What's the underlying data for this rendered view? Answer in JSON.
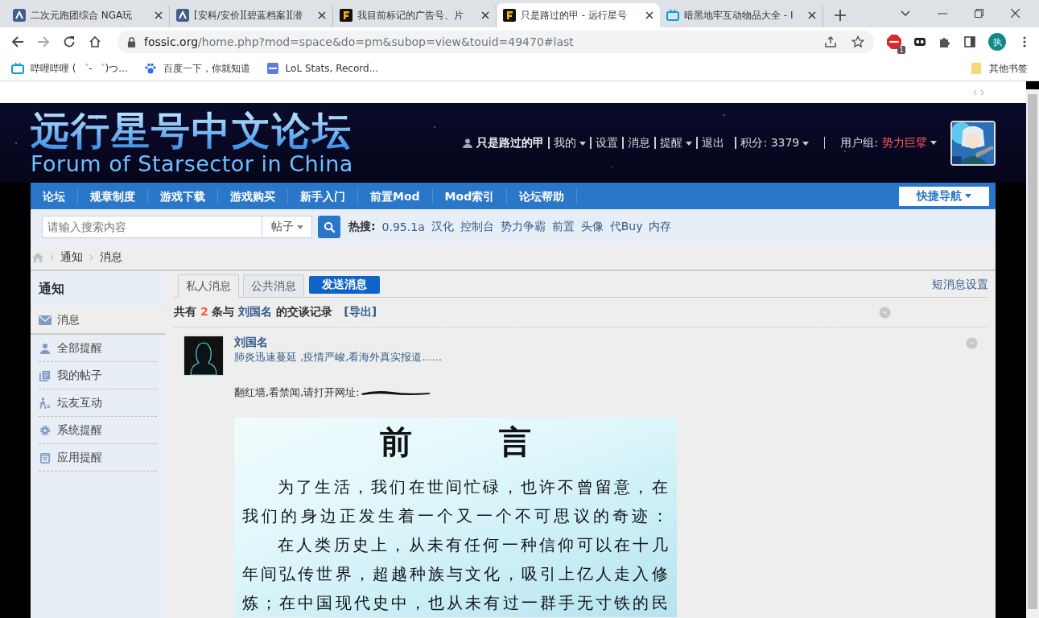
{
  "browser": {
    "tabs": [
      {
        "title": "二次元跑团综合 NGA玩",
        "selected": false,
        "kind": "nga"
      },
      {
        "title": "[安科/安价][碧蓝档案][潜",
        "selected": false,
        "kind": "nga"
      },
      {
        "title": "我目前标记的广告号、片",
        "selected": false,
        "kind": "fossic"
      },
      {
        "title": "只是路过的甲 - 远行星号",
        "selected": true,
        "kind": "fossic"
      },
      {
        "title": "暗黑地牢互动物品大全 - I",
        "selected": false,
        "kind": "bili"
      }
    ],
    "url": {
      "host": "fossic.org",
      "path": "/home.php?mod=space&do=pm&subop=view&touid=49470#last"
    },
    "extension_badge": "1",
    "profile_initial": "执",
    "bookmarks": [
      {
        "label": "哔哩哔哩 ( ゜- ゜)つ..."
      },
      {
        "label": "百度一下，你就知道"
      },
      {
        "label": "LoL Stats, Record..."
      }
    ],
    "other_bookmarks": "其他书签"
  },
  "site": {
    "logo_cn": "远行星号中文论坛",
    "logo_en": "Forum of Starsector in China",
    "user": {
      "name": "只是路过的甲",
      "links": [
        {
          "label": "我的",
          "dropdown": true
        },
        {
          "label": "设置",
          "dropdown": false
        },
        {
          "label": "消息",
          "dropdown": false
        },
        {
          "label": "提醒",
          "dropdown": true
        },
        {
          "label": "退出",
          "dropdown": false
        }
      ],
      "credits_label": "积分: 3379",
      "group_label": "用户组:",
      "group": "势力巨擘"
    },
    "nav": [
      "论坛",
      "规章制度",
      "游戏下载",
      "游戏购买",
      "新手入门",
      "前置Mod",
      "Mod索引",
      "论坛帮助"
    ],
    "quick_nav": "快捷导航",
    "search": {
      "placeholder": "请输入搜索内容",
      "scope": "帖子",
      "hot_label": "热搜:",
      "hot": [
        "0.95.1a",
        "汉化",
        "控制台",
        "势力争霸",
        "前置",
        "头像",
        "代Buy",
        "内存"
      ]
    },
    "breadcrumb": [
      "通知",
      "消息"
    ]
  },
  "sidebar": {
    "title": "通知",
    "items": [
      {
        "label": "消息",
        "selected": true
      },
      {
        "label": "全部提醒",
        "selected": false
      },
      {
        "label": "我的帖子",
        "selected": false
      },
      {
        "label": "坛友互动",
        "selected": false
      },
      {
        "label": "系统提醒",
        "selected": false
      },
      {
        "label": "应用提醒",
        "selected": false
      }
    ]
  },
  "main": {
    "tabs": [
      {
        "label": "私人消息",
        "selected": true
      },
      {
        "label": "公共消息",
        "selected": false
      }
    ],
    "send_button": "发送消息",
    "settings_link": "短消息设置",
    "summary": {
      "prefix": "共有",
      "count": "2",
      "middle": "条与",
      "partner": "刘国名",
      "suffix": "的交谈记录",
      "export": "[导出]"
    },
    "message": {
      "author": "刘国名",
      "subject": "肺炎迅速蔓延 ,疫情严峻,看海外真实报道......",
      "body": "翻红墙,看禁闻,请打开网址:",
      "redacted": true,
      "document": {
        "heading": "前　言",
        "lines": [
          {
            "text": "为了生活，我们在世间忙碌，也许不曾留意，在",
            "indent": true
          },
          {
            "text": "我们的身边正发生着一个又一个不可思议的奇迹：",
            "indent": false
          },
          {
            "text": "在人类历史上，从未有任何一种信仰可以在十几",
            "indent": true
          },
          {
            "text": "年间弘传世界，超越种族与文化，吸引上亿人走入修",
            "indent": false
          },
          {
            "text": "炼；在中国现代史中，也从未有过一群手无寸铁的民",
            "indent": false
          }
        ]
      }
    }
  }
}
